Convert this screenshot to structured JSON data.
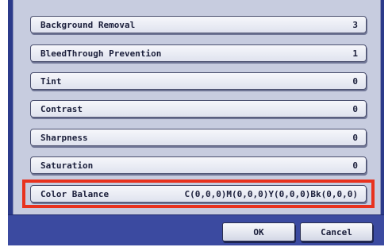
{
  "settings": [
    {
      "label": "Background Removal",
      "value": "3"
    },
    {
      "label": "BleedThrough Prevention",
      "value": "1"
    },
    {
      "label": "Tint",
      "value": "0"
    },
    {
      "label": "Contrast",
      "value": "0"
    },
    {
      "label": "Sharpness",
      "value": "0"
    },
    {
      "label": "Saturation",
      "value": "0"
    },
    {
      "label": "Color Balance",
      "value": "C(0,0,0)M(0,0,0)Y(0,0,0)Bk(0,0,0)"
    }
  ],
  "buttons": {
    "ok_label": "OK",
    "cancel_label": "Cancel"
  },
  "colors": {
    "frame": "#2b3a8a",
    "highlight": "#e8321e"
  }
}
